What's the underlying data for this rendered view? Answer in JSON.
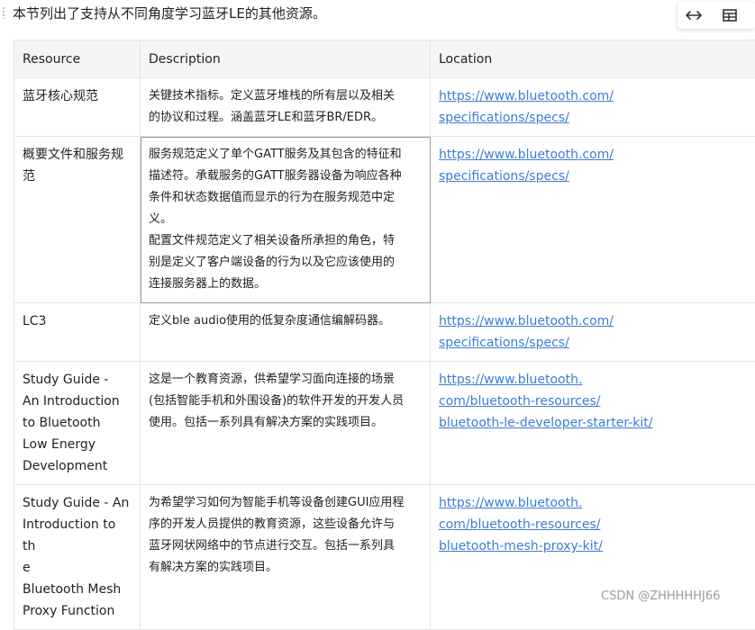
{
  "intro": "本节列出了支持从不同角度学习蓝牙LE的其他资源。",
  "toolbar": {
    "expand_icon": "horizontal-arrows-icon",
    "table_icon": "table-icon"
  },
  "table": {
    "headers": [
      "Resource",
      "Description",
      "Location"
    ],
    "rows": [
      {
        "resource": [
          "蓝牙核心规范"
        ],
        "description": [
          "关键技术指标。定义蓝牙堆栈的所有层以及相关",
          "的协议和过程。涵盖蓝牙LE和蓝牙BR/EDR。"
        ],
        "location": [
          "https://www.bluetooth.com/",
          "specifications/specs/"
        ]
      },
      {
        "resource": [
          "概要文件和服务规",
          "范"
        ],
        "description": [
          "服务规范定义了单个GATT服务及其包含的特征和",
          "描述符。承载服务的GATT服务器设备为响应各种",
          "条件和状态数据值而显示的行为在服务规范中定",
          "义。",
          "配置文件规范定义了相关设备所承担的角色，特",
          "别是定义了客户端设备的行为以及它应该使用的",
          "连接服务器上的数据。"
        ],
        "location": [
          "https://www.bluetooth.com/",
          "specifications/specs/"
        ]
      },
      {
        "resource": [
          "LC3"
        ],
        "description": [
          "定义ble audio使用的低复杂度通信编解码器。"
        ],
        "location": [
          "https://www.bluetooth.com/",
          "specifications/specs/"
        ]
      },
      {
        "resource": [
          "Study Guide -",
          "An Introduction",
          "to Bluetooth",
          "Low Energy",
          "Development"
        ],
        "description": [
          "这是一个教育资源，供希望学习面向连接的场景",
          "(包括智能手机和外围设备)的软件开发的开发人员",
          "使用。包括一系列具有解决方案的实践项目。"
        ],
        "location": [
          "https://www.bluetooth.",
          "com/bluetooth-resources/",
          "bluetooth-le-developer-starter-kit/"
        ]
      },
      {
        "resource": [
          "Study Guide - An",
          "Introduction to th",
          "e",
          "Bluetooth Mesh",
          "Proxy Function"
        ],
        "description": [
          "为希望学习如何为智能手机等设备创建GUI应用程",
          "序的开发人员提供的教育资源，这些设备允许与",
          "蓝牙网状网络中的节点进行交互。包括一系列具",
          "有解决方案的实践项目。"
        ],
        "location": [
          "https://www.bluetooth.",
          "com/bluetooth-resources/",
          "bluetooth-mesh-proxy-kit/"
        ]
      }
    ]
  },
  "watermark": "CSDN @ZHHHHHJ66"
}
